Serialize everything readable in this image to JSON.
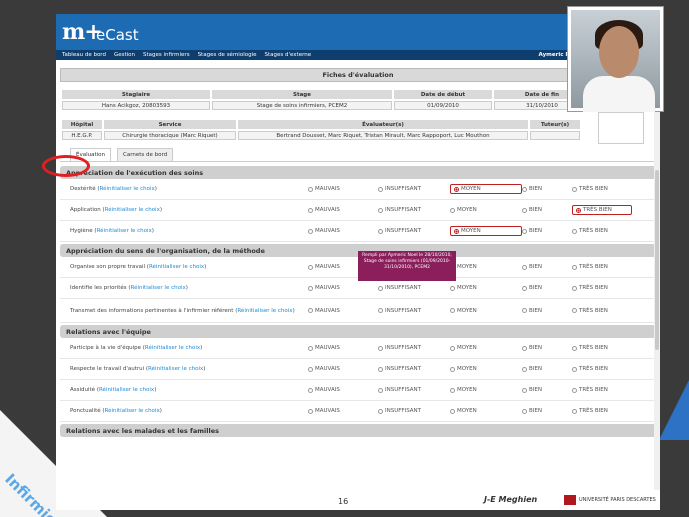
{
  "app": {
    "logo_mark": "m+",
    "name": "eCast"
  },
  "menu": [
    "Tableau de bord",
    "Gestion",
    "Stages infirmiers",
    "Stages de sémiologie",
    "Stages d'externe"
  ],
  "user": "Aymeric N",
  "page_title": "Fiches d'évaluation",
  "info1": {
    "headers": [
      "Stagiaire",
      "Stage",
      "Date de début",
      "Date de fin"
    ],
    "values": [
      "Hans Acikgoz, 20803593",
      "Stage de soins infirmiers, PCEM2",
      "01/09/2010",
      "31/10/2010"
    ]
  },
  "info2": {
    "headers": [
      "Hôpital",
      "Service",
      "Évaluateur(s)",
      "Tuteur(s)"
    ],
    "values": [
      "H.E.G.P.",
      "Chirurgie thoracique (Marc Riquet)",
      "Bertrand Dousset, Marc Riquet, Tristan Mirault, Marc Rappoport, Luc Mouthon",
      ""
    ]
  },
  "tabs": [
    "Évaluation",
    "Carnets de bord"
  ],
  "options": [
    "MAUVAIS",
    "INSUFFISANT",
    "MOYEN",
    "BIEN",
    "TRÈS BIEN"
  ],
  "reset_label": "Réinitialiser le choix",
  "sections": [
    {
      "title": "Appréciation de l'exécution des soins",
      "rows": [
        {
          "label": "Dextérité",
          "selected": 2
        },
        {
          "label": "Application",
          "selected": 4
        },
        {
          "label": "Hygiène",
          "selected": 2
        }
      ]
    },
    {
      "title": "Appréciation du sens de l'organisation, de la méthode",
      "rows": [
        {
          "label": "Organise son propre travail",
          "selected": -1
        },
        {
          "label": "Identifie les priorités",
          "selected": -1
        },
        {
          "label": "Transmet des informations pertinentes à l'infirmier référent",
          "selected": -1
        }
      ]
    },
    {
      "title": "Relations avec l'équipe",
      "rows": [
        {
          "label": "Participe à la vie d'équipe",
          "selected": -1
        },
        {
          "label": "Respecte le travail d'autrui",
          "selected": -1
        },
        {
          "label": "Assiduité",
          "selected": -1
        },
        {
          "label": "Ponctualité",
          "selected": -1
        }
      ]
    },
    {
      "title": "Relations avec les malades et les familles",
      "rows": []
    }
  ],
  "tooltip": "Rempli par Aymeric Noel le 28/10/2010, Stage de soins infirmiers (01/09/2010-31/10/2010), PCEM2",
  "slide": {
    "corner_label": "Infirmier",
    "page_number": "16",
    "author": "J-E Meghien",
    "university": "UNIVERSITÉ PARIS DESCARTES"
  }
}
